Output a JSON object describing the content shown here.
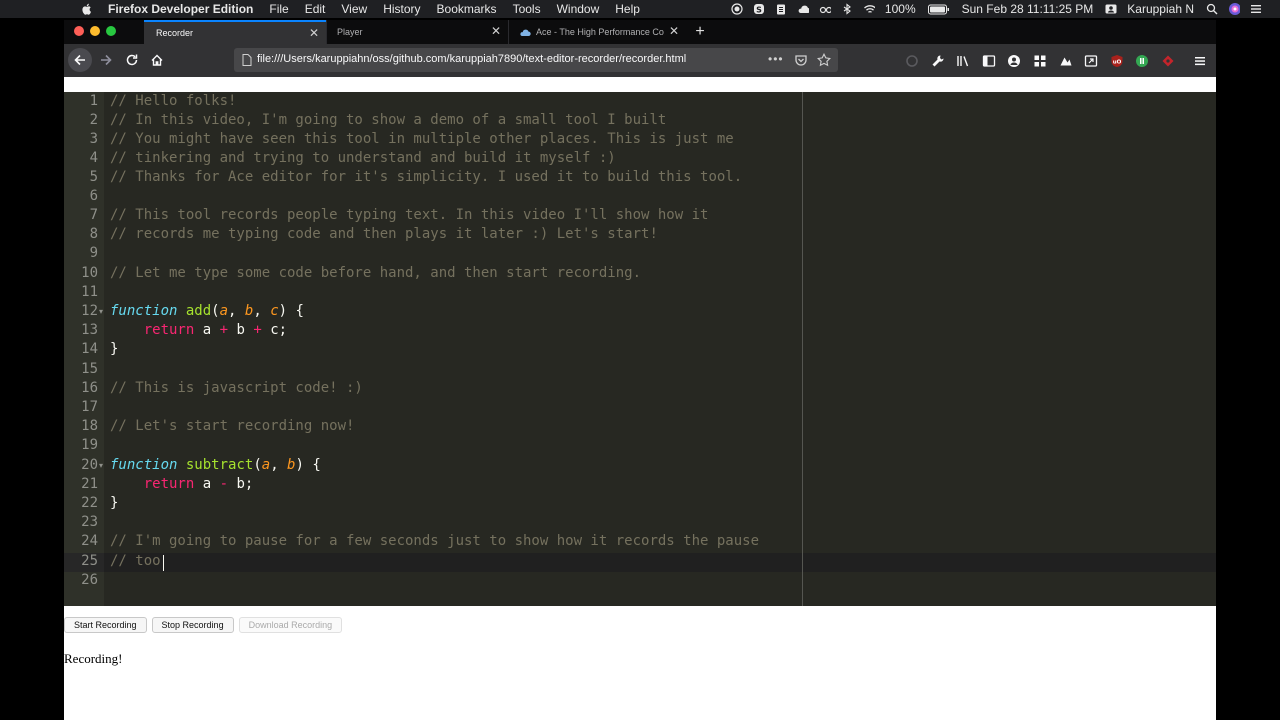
{
  "menubar": {
    "app_name": "Firefox Developer Edition",
    "items": [
      "File",
      "Edit",
      "View",
      "History",
      "Bookmarks",
      "Tools",
      "Window",
      "Help"
    ],
    "battery": "100%",
    "datetime": "Sun Feb 28  11:11:25 PM",
    "user": "Karuppiah N"
  },
  "tabs": [
    {
      "title": "Recorder"
    },
    {
      "title": "Player"
    },
    {
      "title": "Ace - The High Performance Co"
    }
  ],
  "urlbar": {
    "url": "file:///Users/karuppiahn/oss/github.com/karuppiah7890/text-editor-recorder/recorder.html"
  },
  "editor": {
    "line_numbers": [
      "1",
      "2",
      "3",
      "4",
      "5",
      "6",
      "7",
      "8",
      "9",
      "10",
      "11",
      "12",
      "13",
      "14",
      "15",
      "16",
      "17",
      "18",
      "19",
      "20",
      "21",
      "22",
      "23",
      "24",
      "25",
      "26"
    ],
    "lines": {
      "l1": "// Hello folks!",
      "l2": "// In this video, I'm going to show a demo of a small tool I built",
      "l3": "// You might have seen this tool in multiple other places. This is just me",
      "l4": "// tinkering and trying to understand and build it myself :)",
      "l5": "// Thanks for Ace editor for it's simplicity. I used it to build this tool.",
      "l7": "// This tool records people typing text. In this video I'll show how it",
      "l8": "// records me typing code and then plays it later :) Let's start!",
      "l10": "// Let me type some code before hand, and then start recording.",
      "l16": "// This is javascript code! :)",
      "l18": "// Let's start recording now!",
      "l24": "// I'm going to pause for a few seconds just to show how it records the pause",
      "l25": "// too"
    },
    "tokens": {
      "kw_function": "function",
      "fn_add": "add",
      "fn_subtract": "subtract",
      "paren_open": "(",
      "p_a": "a",
      "p_b": "b",
      "p_c": "c",
      "comma": ", ",
      "paren_close_brace": ") {",
      "indent": "    ",
      "kw_return": "return",
      "v_a": " a ",
      "op_plus": "+",
      "op_minus": "-",
      "v_b": " b ",
      "v_b_end": " b;",
      "v_c_end": " c;",
      "brace_close": "}"
    }
  },
  "controls": {
    "start": "Start Recording",
    "stop": "Stop Recording",
    "download": "Download Recording"
  },
  "status": "Recording!"
}
